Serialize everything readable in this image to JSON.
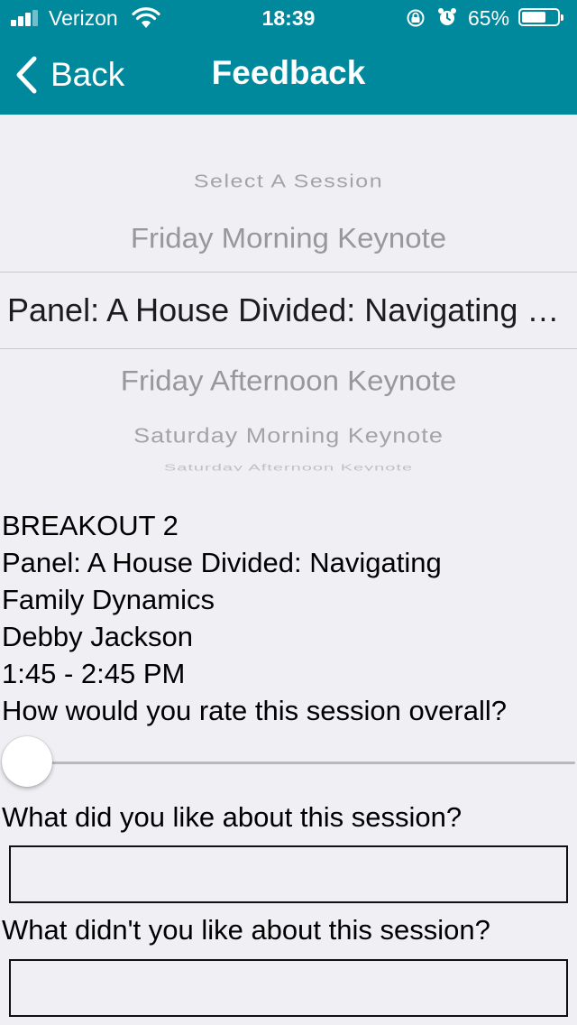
{
  "status_bar": {
    "carrier": "Verizon",
    "time": "18:39",
    "battery_percent": "65%",
    "battery_level": 0.65,
    "icons": [
      "signal-icon",
      "wifi-icon",
      "orientation-lock-icon",
      "alarm-icon",
      "battery-icon"
    ]
  },
  "nav": {
    "back_label": "Back",
    "title": "Feedback"
  },
  "picker": {
    "items": [
      "Select A Session",
      "Friday Morning Keynote",
      "Panel: A House Divided: Navigating Family Dynamics",
      "Friday Afternoon Keynote",
      "Saturday Morning Keynote",
      "Saturday Afternoon Keynote"
    ],
    "selected_index": 2
  },
  "session": {
    "type": "BREAKOUT 2",
    "title_line1": "Panel: A House Divided: Navigating",
    "title_line2": "Family Dynamics",
    "speaker": "Debby Jackson",
    "time": "1:45 - 2:45 PM"
  },
  "rating": {
    "question": "How would you rate this session overall?",
    "value": 0
  },
  "questions": {
    "liked": "What did you like about this session?",
    "liked_value": "",
    "disliked": "What didn't you like about this session?",
    "disliked_value": ""
  },
  "colors": {
    "header": "#00899c",
    "background": "#efeff4"
  }
}
